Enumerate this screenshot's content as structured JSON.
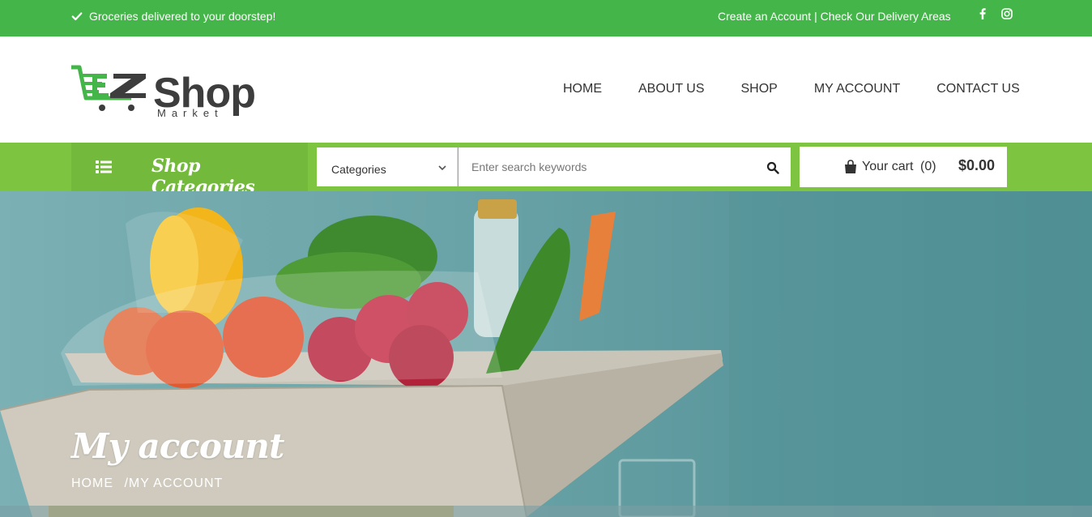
{
  "topbar": {
    "promo_text": "Groceries delivered to your doorstep!",
    "create_account": "Create an Account",
    "separator": " | ",
    "delivery_areas": "Check Our Delivery Areas",
    "social": [
      "facebook-icon",
      "instagram-icon"
    ]
  },
  "brand": {
    "logo_letters": "EZ",
    "logo_word": "Shop",
    "logo_sub": "Market",
    "green": "#44b649",
    "dark": "#3d3d3d"
  },
  "nav": {
    "items": [
      {
        "label": "HOME"
      },
      {
        "label": "ABOUT US"
      },
      {
        "label": "SHOP"
      },
      {
        "label": "MY ACCOUNT"
      },
      {
        "label": "CONTACT US"
      }
    ]
  },
  "catbar": {
    "shop_categories": "Shop Categories",
    "select_value": "Categories",
    "search_placeholder": "Enter search keywords",
    "cart_label": "Your cart",
    "cart_count": "(0)",
    "cart_total": "$0.00",
    "bar_color": "#7dc441"
  },
  "hero": {
    "title": "My account",
    "breadcrumb": {
      "home": "HOME",
      "separator": "/",
      "current": "MY ACCOUNT"
    }
  }
}
